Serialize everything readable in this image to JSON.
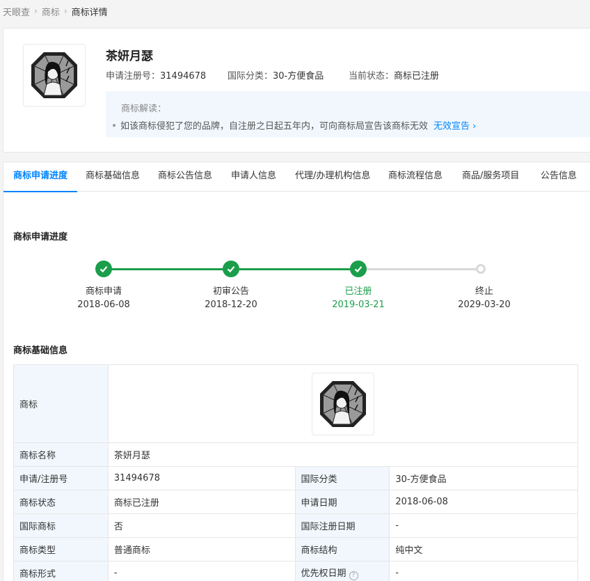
{
  "breadcrumb": [
    "天眼查",
    "商标",
    "商标详情"
  ],
  "trademark": {
    "name": "茶妍月瑟",
    "reg_label": "申请注册号：",
    "reg_no": "31494678",
    "class_label": "国际分类：",
    "class_value": "30-方便食品",
    "status_label": "当前状态：",
    "status_value": "商标已注册"
  },
  "interpretation": {
    "title": "商标解读：",
    "text": "如该商标侵犯了您的品牌，自注册之日起五年内，可向商标局宣告该商标无效",
    "link": "无效宣告"
  },
  "tabs": [
    "商标申请进度",
    "商标基础信息",
    "商标公告信息",
    "申请人信息",
    "代理/办理机构信息",
    "商标流程信息",
    "商品/服务项目",
    "公告信息"
  ],
  "progress_section": {
    "title": "商标申请进度",
    "steps": [
      {
        "label": "商标申请",
        "date": "2018-06-08",
        "done": true
      },
      {
        "label": "初审公告",
        "date": "2018-12-20",
        "done": true
      },
      {
        "label": "已注册",
        "date": "2019-03-21",
        "done": true
      },
      {
        "label": "终止",
        "date": "2029-03-20",
        "done": false
      }
    ]
  },
  "basic_section": {
    "title": "商标基础信息",
    "logo_label": "商标",
    "name_label": "商标名称",
    "name_value": "茶妍月瑟",
    "rows": [
      [
        "申请/注册号",
        "31494678",
        "国际分类",
        "30-方便食品"
      ],
      [
        "商标状态",
        "商标已注册",
        "申请日期",
        "2018-06-08"
      ],
      [
        "国际商标",
        "否",
        "国际注册日期",
        "-"
      ],
      [
        "商标类型",
        "普通商标",
        "商标结构",
        "纯中文"
      ],
      [
        "商标形式",
        "-",
        "优先权日期",
        "-"
      ]
    ]
  },
  "colors": {
    "accent": "#0084ff",
    "success": "#1b9e4b",
    "label_bg": "#f1f7fd"
  },
  "icons": {
    "check": "check-icon",
    "help": "question-icon",
    "arrow": "chevron-right-icon"
  }
}
